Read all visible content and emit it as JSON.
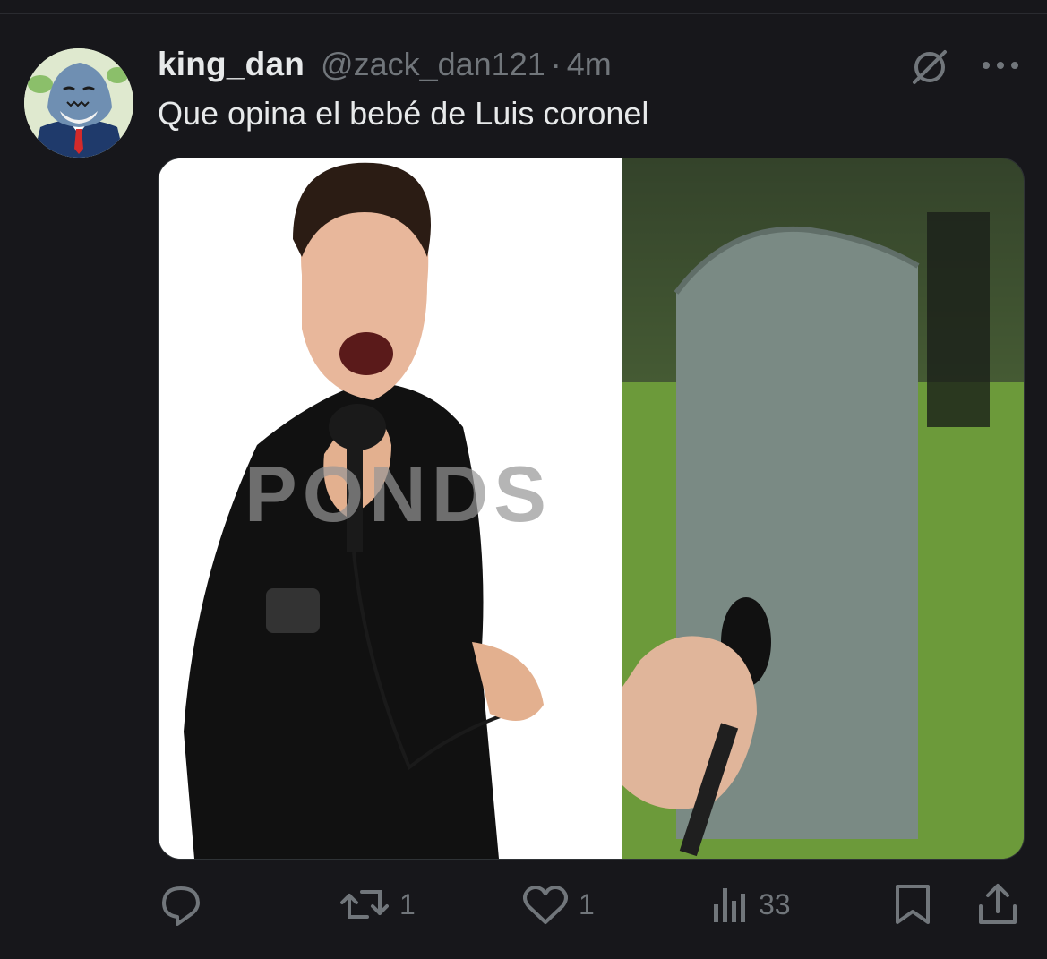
{
  "tweet": {
    "author_name": "king_dan",
    "handle": "@zack_dan121",
    "separator": "·",
    "time": "4m",
    "text": "Que opina el bebé de Luis coronel",
    "media_watermark": "PONDS"
  },
  "actions": {
    "reply": {
      "icon": "reply-icon"
    },
    "retweet": {
      "icon": "retweet-icon",
      "count": "1"
    },
    "like": {
      "icon": "heart-icon",
      "count": "1"
    },
    "views": {
      "icon": "views-icon",
      "count": "33"
    },
    "bookmark": {
      "icon": "bookmark-icon"
    },
    "share": {
      "icon": "share-icon"
    }
  },
  "header_icons": {
    "grok": "grok-icon",
    "more": "more-icon"
  },
  "colors": {
    "background": "#17171b",
    "text_primary": "#e7e9ea",
    "text_secondary": "#71767b"
  }
}
